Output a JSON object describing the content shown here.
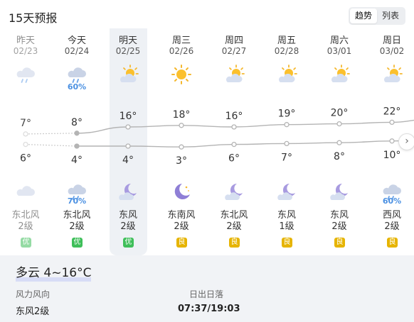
{
  "header": {
    "title": "15天预报",
    "tabs": [
      {
        "label": "趋势",
        "active": true
      },
      {
        "label": "列表",
        "active": false
      }
    ]
  },
  "days": [
    {
      "weekday": "昨天",
      "date": "02/23",
      "day_icon": "cloudy-rain-icon",
      "day_pop": "",
      "night_icon": "cloudy-night-icon",
      "night_pop": "",
      "high": 7,
      "low": 6,
      "wind_dir": "东北风",
      "wind_level": "2级",
      "aqi": "优",
      "aqi_level": "good",
      "past": true
    },
    {
      "weekday": "今天",
      "date": "02/24",
      "day_icon": "cloudy-rain-icon",
      "day_pop": "60%",
      "night_icon": "cloudy-rain-icon",
      "night_pop": "70%",
      "high": 8,
      "low": 4,
      "wind_dir": "东北风",
      "wind_level": "2级",
      "aqi": "优",
      "aqi_level": "good"
    },
    {
      "weekday": "明天",
      "date": "02/25",
      "day_icon": "partly-cloudy-sun-icon",
      "day_pop": "",
      "night_icon": "moon-cloud-icon",
      "night_pop": "",
      "high": 16,
      "low": 4,
      "wind_dir": "东风",
      "wind_level": "2级",
      "aqi": "优",
      "aqi_level": "good",
      "selected": true
    },
    {
      "weekday": "周三",
      "date": "02/26",
      "day_icon": "sunny-icon",
      "day_pop": "",
      "night_icon": "clear-moon-icon",
      "night_pop": "",
      "high": 18,
      "low": 3,
      "wind_dir": "东南风",
      "wind_level": "2级",
      "aqi": "良",
      "aqi_level": "moderate"
    },
    {
      "weekday": "周四",
      "date": "02/27",
      "day_icon": "partly-cloudy-sun-icon",
      "day_pop": "",
      "night_icon": "moon-cloud-icon",
      "night_pop": "",
      "high": 16,
      "low": 6,
      "wind_dir": "东北风",
      "wind_level": "2级",
      "aqi": "良",
      "aqi_level": "moderate"
    },
    {
      "weekday": "周五",
      "date": "02/28",
      "day_icon": "partly-cloudy-sun-icon",
      "day_pop": "",
      "night_icon": "moon-cloud-icon",
      "night_pop": "",
      "high": 19,
      "low": 7,
      "wind_dir": "东风",
      "wind_level": "1级",
      "aqi": "良",
      "aqi_level": "moderate"
    },
    {
      "weekday": "周六",
      "date": "03/01",
      "day_icon": "partly-cloudy-sun-icon",
      "day_pop": "",
      "night_icon": "moon-cloud-icon",
      "night_pop": "",
      "high": 20,
      "low": 8,
      "wind_dir": "东风",
      "wind_level": "2级",
      "aqi": "良",
      "aqi_level": "moderate"
    },
    {
      "weekday": "周日",
      "date": "03/02",
      "day_icon": "partly-cloudy-sun-icon",
      "day_pop": "",
      "night_icon": "cloudy-rain-icon",
      "night_pop": "60%",
      "high": 22,
      "low": 10,
      "wind_dir": "西风",
      "wind_level": "2级",
      "aqi": "良",
      "aqi_level": "moderate"
    }
  ],
  "detail": {
    "condition": "多云 4~16°C",
    "wind_label": "风力风向",
    "wind_value": "东风2级",
    "sun_label": "日出日落",
    "sun_value": "07:37/19:03"
  },
  "colors": {
    "good": "#3fbf5a",
    "moderate": "#e6b400",
    "rain": "#4a90e2",
    "line": "#b4b4b4"
  }
}
